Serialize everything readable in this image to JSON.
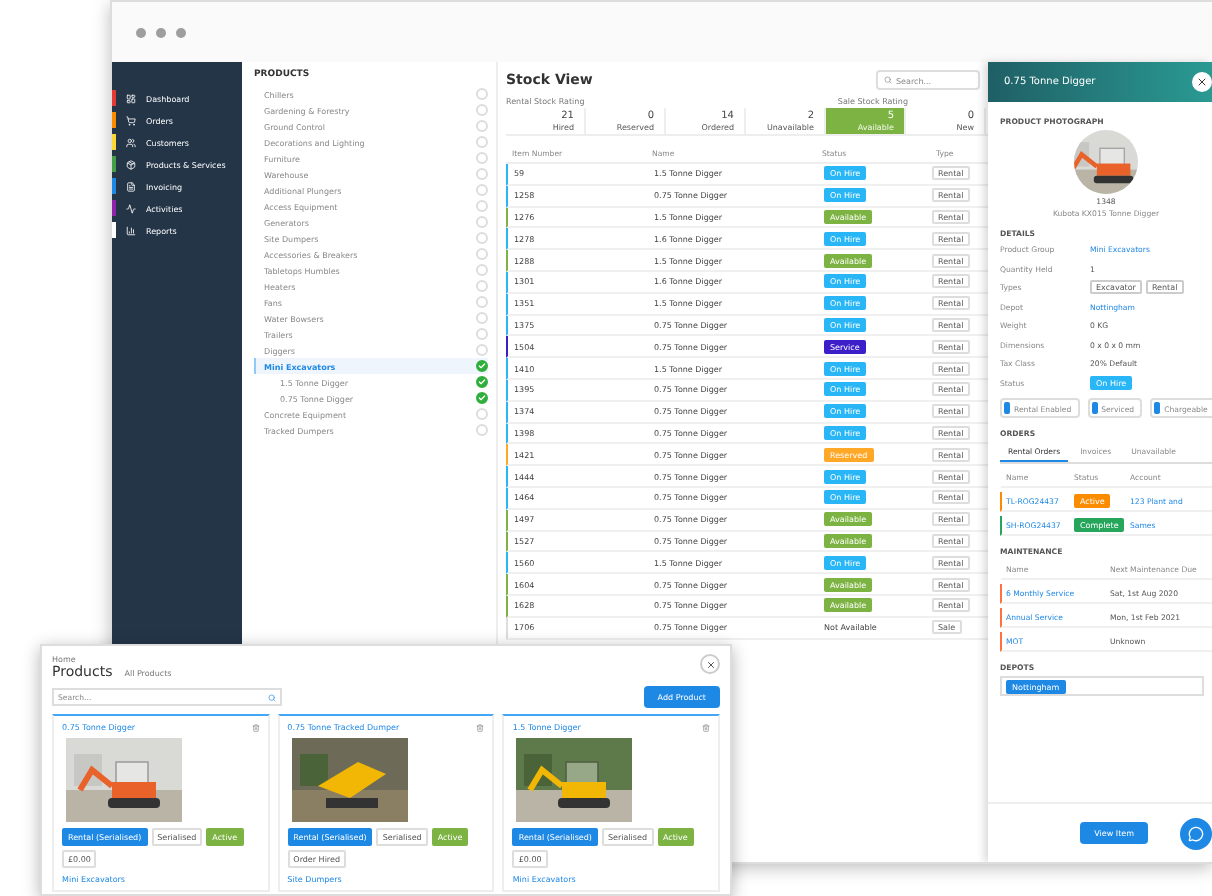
{
  "sidebar": {
    "items": [
      {
        "label": "Dashboard",
        "color": "#e53935"
      },
      {
        "label": "Orders",
        "color": "#fb8c00"
      },
      {
        "label": "Customers",
        "color": "#fdd835"
      },
      {
        "label": "Products & Services",
        "color": "#43a047"
      },
      {
        "label": "Invoicing",
        "color": "#1e88e5"
      },
      {
        "label": "Activities",
        "color": "#8e24aa"
      },
      {
        "label": "Reports",
        "color": "#ffffff"
      }
    ]
  },
  "tree": {
    "title": "PRODUCTS",
    "items": [
      {
        "label": "Chillers",
        "checked": false,
        "selected": false
      },
      {
        "label": "Gardening & Forestry",
        "checked": false,
        "selected": false
      },
      {
        "label": "Ground Control",
        "checked": false,
        "selected": false
      },
      {
        "label": "Decorations and Lighting",
        "checked": false,
        "selected": false
      },
      {
        "label": "Furniture",
        "checked": false,
        "selected": false
      },
      {
        "label": "Warehouse",
        "checked": false,
        "selected": false
      },
      {
        "label": "Additional Plungers",
        "checked": false,
        "selected": false
      },
      {
        "label": "Access Equipment",
        "checked": false,
        "selected": false
      },
      {
        "label": "Generators",
        "checked": false,
        "selected": false
      },
      {
        "label": "Site Dumpers",
        "checked": false,
        "selected": false
      },
      {
        "label": "Accessories & Breakers",
        "checked": false,
        "selected": false
      },
      {
        "label": "Tabletops Humbles",
        "checked": false,
        "selected": false
      },
      {
        "label": "Heaters",
        "checked": false,
        "selected": false
      },
      {
        "label": "Fans",
        "checked": false,
        "selected": false
      },
      {
        "label": "Water Bowsers",
        "checked": false,
        "selected": false
      },
      {
        "label": "Trailers",
        "checked": false,
        "selected": false
      },
      {
        "label": "Diggers",
        "checked": false,
        "selected": false
      },
      {
        "label": "Mini Excavators",
        "checked": true,
        "selected": true,
        "children": [
          {
            "label": "1.5 Tonne Digger",
            "checked": true,
            "selected": false
          },
          {
            "label": "0.75 Tonne Digger",
            "checked": true,
            "selected": false
          }
        ]
      },
      {
        "label": "Concrete Equipment",
        "checked": false,
        "selected": false
      },
      {
        "label": "Tracked Dumpers",
        "checked": false,
        "selected": false
      }
    ]
  },
  "stock": {
    "title": "Stock View",
    "search": {
      "placeholder": "Search..."
    },
    "rental_label": "Rental Stock Rating",
    "sale_label": "Sale Stock Rating",
    "stats": [
      {
        "value": "21",
        "label": "Hired",
        "selected": false
      },
      {
        "value": "0",
        "label": "Reserved",
        "selected": false
      },
      {
        "value": "14",
        "label": "Ordered",
        "selected": false
      },
      {
        "value": "2",
        "label": "Unavailable",
        "selected": false
      },
      {
        "value": "5",
        "label": "Available",
        "selected": true
      },
      {
        "value": "0",
        "label": "New",
        "selected": false
      }
    ],
    "columns": [
      "Item Number",
      "Name",
      "Status",
      "Type"
    ],
    "rows": [
      {
        "number": "59",
        "name": "1.5 Tonne Digger",
        "status": "On Hire",
        "kind": "badge",
        "color": "#29b6f6",
        "type": "Rental"
      },
      {
        "number": "1258",
        "name": "0.75 Tonne Digger",
        "status": "On Hire",
        "kind": "badge",
        "color": "#29b6f6",
        "type": "Rental"
      },
      {
        "number": "1276",
        "name": "1.5 Tonne Digger",
        "status": "Available",
        "kind": "badge",
        "color": "#7cb342",
        "type": "Rental"
      },
      {
        "number": "1278",
        "name": "1.6 Tonne Digger",
        "status": "On Hire",
        "kind": "badge",
        "color": "#29b6f6",
        "type": "Rental"
      },
      {
        "number": "1288",
        "name": "1.5 Tonne Digger",
        "status": "Available",
        "kind": "badge",
        "color": "#7cb342",
        "type": "Rental"
      },
      {
        "number": "1301",
        "name": "1.6 Tonne Digger",
        "status": "On Hire",
        "kind": "badge",
        "color": "#29b6f6",
        "type": "Rental"
      },
      {
        "number": "1351",
        "name": "1.5 Tonne Digger",
        "status": "On Hire",
        "kind": "badge",
        "color": "#29b6f6",
        "type": "Rental"
      },
      {
        "number": "1375",
        "name": "0.75 Tonne Digger",
        "status": "On Hire",
        "kind": "badge",
        "color": "#29b6f6",
        "type": "Rental"
      },
      {
        "number": "1504",
        "name": "0.75 Tonne Digger",
        "status": "Service",
        "kind": "badge",
        "color": "#3d1fc9",
        "type": "Rental"
      },
      {
        "number": "1410",
        "name": "1.5 Tonne Digger",
        "status": "On Hire",
        "kind": "badge",
        "color": "#29b6f6",
        "type": "Rental"
      },
      {
        "number": "1395",
        "name": "0.75 Tonne Digger",
        "status": "On Hire",
        "kind": "badge",
        "color": "#29b6f6",
        "type": "Rental"
      },
      {
        "number": "1374",
        "name": "0.75 Tonne Digger",
        "status": "On Hire",
        "kind": "badge",
        "color": "#29b6f6",
        "type": "Rental"
      },
      {
        "number": "1398",
        "name": "0.75 Tonne Digger",
        "status": "On Hire",
        "kind": "badge",
        "color": "#29b6f6",
        "type": "Rental"
      },
      {
        "number": "1421",
        "name": "0.75 Tonne Digger",
        "status": "Reserved",
        "kind": "badge",
        "color": "#ffa726",
        "type": "Rental"
      },
      {
        "number": "1444",
        "name": "0.75 Tonne Digger",
        "status": "On Hire",
        "kind": "badge",
        "color": "#29b6f6",
        "type": "Rental"
      },
      {
        "number": "1464",
        "name": "0.75 Tonne Digger",
        "status": "On Hire",
        "kind": "badge",
        "color": "#29b6f6",
        "type": "Rental"
      },
      {
        "number": "1497",
        "name": "0.75 Tonne Digger",
        "status": "Available",
        "kind": "badge",
        "color": "#7cb342",
        "type": "Rental"
      },
      {
        "number": "1527",
        "name": "0.75 Tonne Digger",
        "status": "Available",
        "kind": "badge",
        "color": "#7cb342",
        "type": "Rental"
      },
      {
        "number": "1560",
        "name": "1.5 Tonne Digger",
        "status": "On Hire",
        "kind": "badge",
        "color": "#29b6f6",
        "type": "Rental"
      },
      {
        "number": "1604",
        "name": "0.75 Tonne Digger",
        "status": "Available",
        "kind": "badge",
        "color": "#7cb342",
        "type": "Rental"
      },
      {
        "number": "1628",
        "name": "0.75 Tonne Digger",
        "status": "Available",
        "kind": "badge",
        "color": "#7cb342",
        "type": "Rental"
      },
      {
        "number": "1706",
        "name": "0.75 Tonne Digger",
        "status": "Not Available",
        "kind": "plain",
        "color": "#dddddd",
        "type": "Sale"
      }
    ]
  },
  "detail": {
    "title": "0.75 Tonne Digger",
    "photo_heading": "PRODUCT PHOTOGRAPH",
    "item_number": "1348",
    "item_name": "Kubota KX015 Tonne Digger",
    "details_heading": "DETAILS",
    "fields": [
      {
        "label": "Product Group",
        "value": "Mini Excavators",
        "kind": "link"
      },
      {
        "label": "Quantity Held",
        "value": "1",
        "kind": "text"
      },
      {
        "label": "Types",
        "values": [
          "Excavator",
          "Rental"
        ],
        "kind": "tags"
      },
      {
        "label": "Depot",
        "value": "Nottingham",
        "kind": "link"
      },
      {
        "label": "Weight",
        "value": "0 KG",
        "kind": "text"
      },
      {
        "label": "Dimensions",
        "value": "0 x 0 x 0 mm",
        "kind": "text"
      },
      {
        "label": "Tax Class",
        "value": "20% Default",
        "kind": "text"
      },
      {
        "label": "Status",
        "value": "On Hire",
        "kind": "badge"
      }
    ],
    "toggles": [
      {
        "label": "Rental Enabled",
        "on": true
      },
      {
        "label": "Serviced",
        "on": true
      },
      {
        "label": "Chargeable",
        "on": true
      }
    ],
    "orders_heading": "ORDERS",
    "order_tabs": [
      {
        "label": "Rental Orders",
        "selected": true
      },
      {
        "label": "Invoices",
        "selected": false
      },
      {
        "label": "Unavailable",
        "selected": false
      }
    ],
    "order_columns": [
      "Name",
      "Status",
      "Account"
    ],
    "orders": [
      {
        "name": "TL-ROG24437",
        "status": "Active",
        "color": "#fb8c00",
        "account": "123 Plant and"
      },
      {
        "name": "SH-ROG24437",
        "status": "Complete",
        "color": "#26a65b",
        "account": "Sames"
      }
    ],
    "maintenance_heading": "MAINTENANCE",
    "maintenance_columns": [
      "Name",
      "Next Maintenance Due"
    ],
    "maintenance": [
      {
        "name": "6 Monthly Service",
        "due": "Sat, 1st Aug 2020"
      },
      {
        "name": "Annual Service",
        "due": "Mon, 1st Feb 2021"
      },
      {
        "name": "MOT",
        "due": "Unknown"
      }
    ],
    "depots_heading": "DEPOTS",
    "depots": [
      "Nottingham"
    ],
    "view_button": "View Item"
  },
  "products_window": {
    "breadcrumb": "Home",
    "title": "Products",
    "subtitle": "All Products",
    "search": {
      "placeholder": "Search..."
    },
    "add_button": "Add Product",
    "cards": [
      {
        "title": "0.75 Tonne Digger",
        "tags": [
          "Rental (Serialised)",
          "Serialised",
          "Active",
          "£0.00"
        ],
        "group": "Mini Excavators"
      },
      {
        "title": "0.75 Tonne Tracked Dumper",
        "tags": [
          "Rental (Serialised)",
          "Serialised",
          "Active",
          "Order Hired"
        ],
        "group": "Site Dumpers"
      },
      {
        "title": "1.5 Tonne Digger",
        "tags": [
          "Rental (Serialised)",
          "Serialised",
          "Active",
          "£0.00"
        ],
        "group": "Mini Excavators"
      }
    ]
  }
}
